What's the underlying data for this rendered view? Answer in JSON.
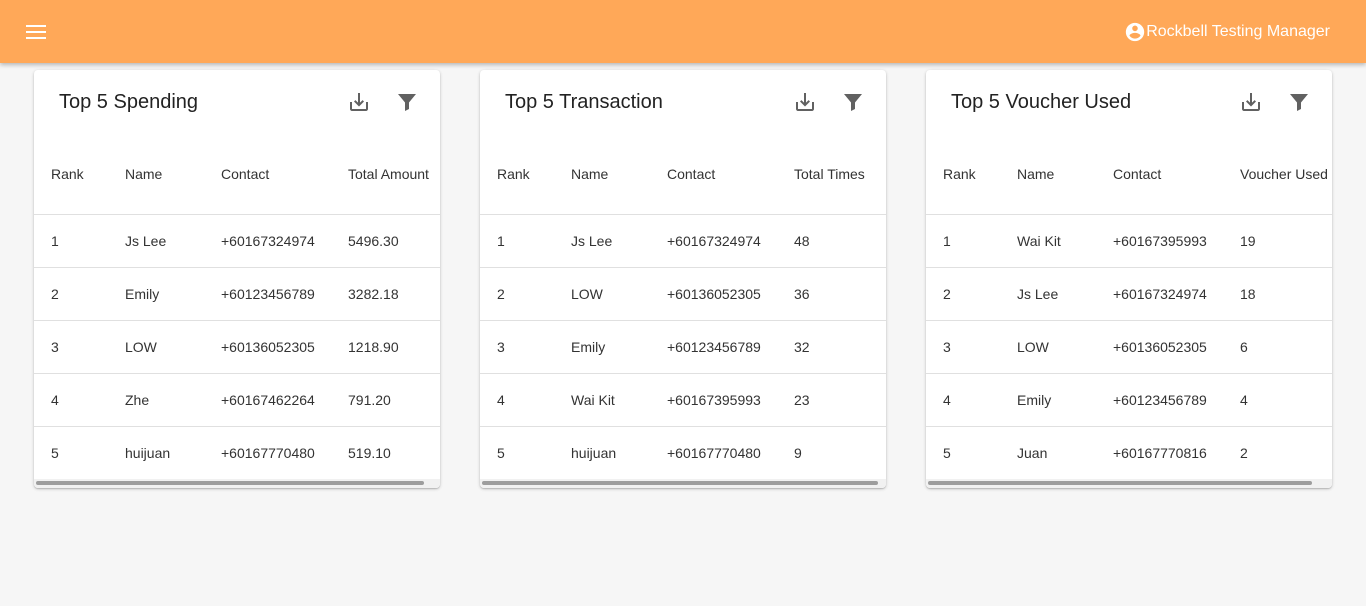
{
  "appbar": {
    "user_name": "Rockbell Testing Manager"
  },
  "cards": [
    {
      "title": "Top 5 Spending",
      "columns": [
        "Rank",
        "Name",
        "Contact",
        "Total Amount"
      ],
      "rows": [
        [
          "1",
          "Js Lee",
          "+60167324974",
          "5496.30"
        ],
        [
          "2",
          "Emily",
          "+60123456789",
          "3282.18"
        ],
        [
          "3",
          "LOW",
          "+60136052305",
          "1218.90"
        ],
        [
          "4",
          "Zhe",
          "+60167462264",
          "791.20"
        ],
        [
          "5",
          "huijuan",
          "+60167770480",
          "519.10"
        ]
      ]
    },
    {
      "title": "Top 5 Transaction",
      "columns": [
        "Rank",
        "Name",
        "Contact",
        "Total Times"
      ],
      "rows": [
        [
          "1",
          "Js Lee",
          "+60167324974",
          "48"
        ],
        [
          "2",
          "LOW",
          "+60136052305",
          "36"
        ],
        [
          "3",
          "Emily",
          "+60123456789",
          "32"
        ],
        [
          "4",
          "Wai Kit",
          "+60167395993",
          "23"
        ],
        [
          "5",
          "huijuan",
          "+60167770480",
          "9"
        ]
      ]
    },
    {
      "title": "Top 5 Voucher Used",
      "columns": [
        "Rank",
        "Name",
        "Contact",
        "Voucher Used"
      ],
      "rows": [
        [
          "1",
          "Wai Kit",
          "+60167395993",
          "19"
        ],
        [
          "2",
          "Js Lee",
          "+60167324974",
          "18"
        ],
        [
          "3",
          "LOW",
          "+60136052305",
          "6"
        ],
        [
          "4",
          "Emily",
          "+60123456789",
          "4"
        ],
        [
          "5",
          "Juan",
          "+60167770816",
          "2"
        ]
      ]
    }
  ],
  "colors": {
    "appbar": "#ffa858",
    "icon": "#616161"
  },
  "icons": {
    "menu": "menu-icon",
    "user": "account-circle-icon",
    "download": "download-icon",
    "filter": "filter-icon"
  }
}
